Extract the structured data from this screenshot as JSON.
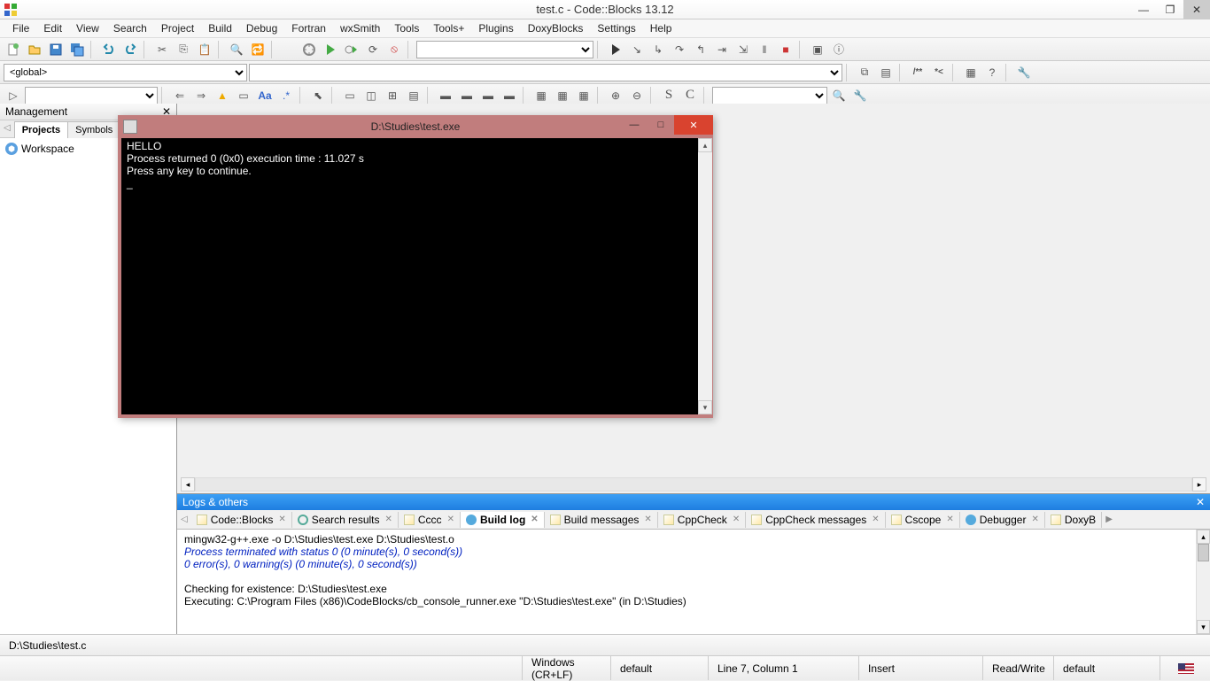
{
  "window": {
    "title": "test.c - Code::Blocks 13.12"
  },
  "menu": [
    "File",
    "Edit",
    "View",
    "Search",
    "Project",
    "Build",
    "Debug",
    "Fortran",
    "wxSmith",
    "Tools",
    "Tools+",
    "Plugins",
    "DoxyBlocks",
    "Settings",
    "Help"
  ],
  "scope_selector": "<global>",
  "management": {
    "title": "Management",
    "tabs": [
      "Projects",
      "Symbols"
    ],
    "active_tab": 0,
    "workspace_label": "Workspace"
  },
  "console": {
    "title": "D:\\Studies\\test.exe",
    "lines": [
      "HELLO",
      "Process returned 0 (0x0)   execution time : 11.027 s",
      "Press any key to continue."
    ]
  },
  "logs": {
    "title": "Logs & others",
    "tabs": [
      "Code::Blocks",
      "Search results",
      "Cccc",
      "Build log",
      "Build messages",
      "CppCheck",
      "CppCheck messages",
      "Cscope",
      "Debugger",
      "DoxyB"
    ],
    "active_tab": 3,
    "build_log": {
      "line1": "mingw32-g++.exe  -o D:\\Studies\\test.exe D:\\Studies\\test.o",
      "line2": "Process terminated with status 0 (0 minute(s), 0 second(s))",
      "line3": "0 error(s), 0 warning(s) (0 minute(s), 0 second(s))",
      "line4": "Checking for existence: D:\\Studies\\test.exe",
      "line5": "Executing: C:\\Program Files (x86)\\CodeBlocks/cb_console_runner.exe \"D:\\Studies\\test.exe\" (in D:\\Studies)"
    }
  },
  "status": {
    "file_path": "D:\\Studies\\test.c",
    "line_ending": "Windows (CR+LF)",
    "encoding": "default",
    "cursor": "Line 7, Column 1",
    "mode": "Insert",
    "access": "Read/Write",
    "profile": "default"
  }
}
